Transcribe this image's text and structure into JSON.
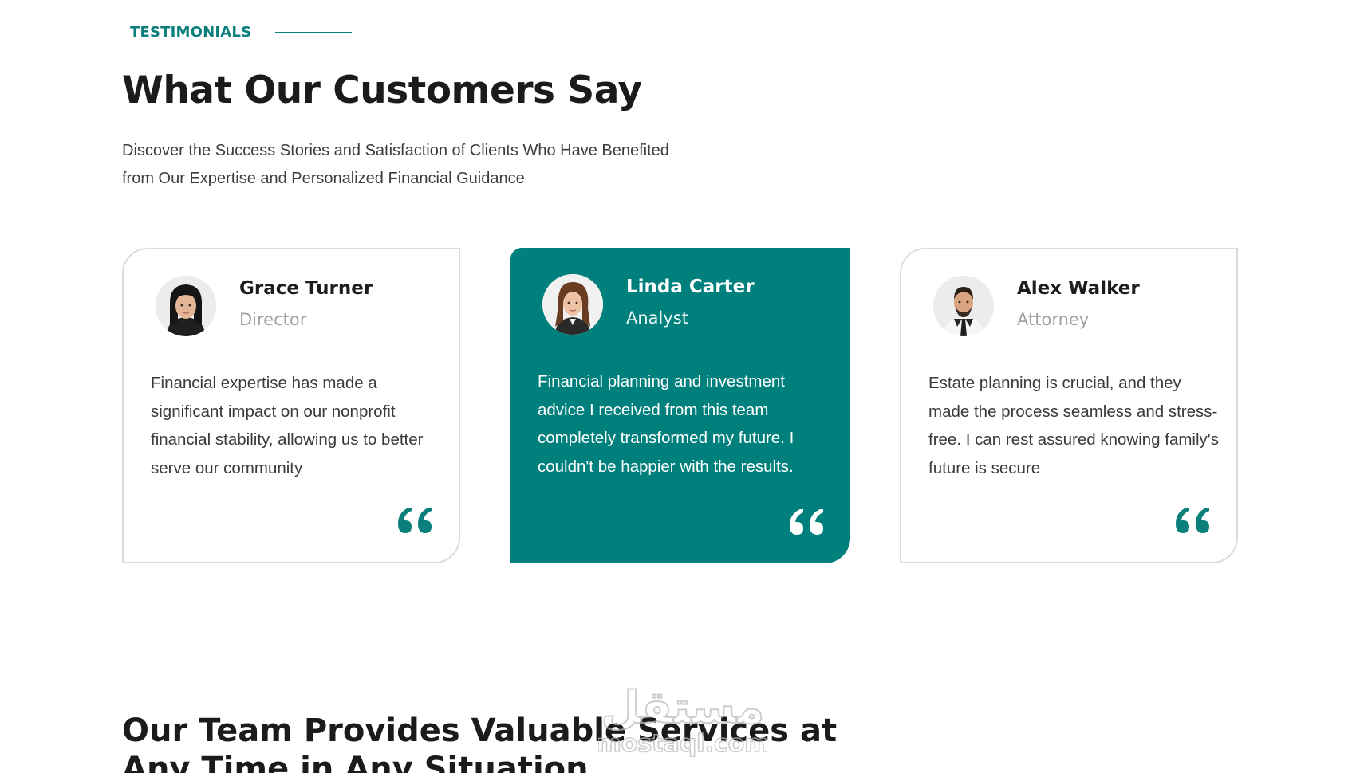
{
  "section": {
    "eyebrow": "TESTIMONIALS",
    "title": "What Our Customers Say",
    "subtitle": "Discover the Success Stories and Satisfaction of Clients Who Have Benefited from Our Expertise and Personalized Financial Guidance"
  },
  "testimonials": [
    {
      "name": "Grace Turner",
      "role": "Director",
      "quote": "Financial expertise has made a significant impact on our nonprofit financial stability, allowing us to better serve our community",
      "highlighted": false
    },
    {
      "name": "Linda Carter",
      "role": "Analyst",
      "quote": "Financial planning and investment advice I received from this team completely transformed my future. I couldn't be happier with the results.",
      "highlighted": true
    },
    {
      "name": "Alex Walker",
      "role": "Attorney",
      "quote": "Estate planning is crucial, and they made the process seamless and stress-free. I can rest assured knowing family's future is secure",
      "highlighted": false
    }
  ],
  "next_section": {
    "title": "Our Team Provides Valuable Services at Any Time in Any Situation"
  },
  "watermark": {
    "text_arabic": "مستقل",
    "text_latin": "mostaql.com"
  },
  "colors": {
    "accent": "#00807c",
    "card_border": "#dcdcdc",
    "heading": "#1b1b1b",
    "muted": "#a2a2a2"
  },
  "icons": [
    "quote-icon",
    "avatar-grace-turner",
    "avatar-linda-carter",
    "avatar-alex-walker"
  ]
}
